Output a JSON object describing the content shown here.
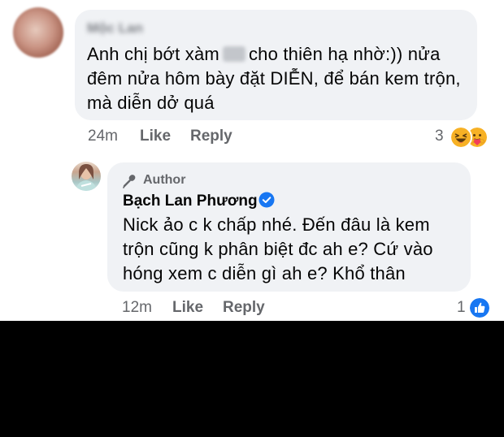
{
  "comment": {
    "author": "Mộc Lan",
    "text_before": "Anh chị bớt xàm",
    "text_after": "cho thiên hạ nhờ:)) nửa đêm nửa hôm bày đặt DIỄN, để bán kem trộn, mà diễn dở quá",
    "time": "24m",
    "like_label": "Like",
    "reply_label": "Reply",
    "reaction_count": "3",
    "reaction_icons": [
      "haha-icon",
      "care-icon"
    ]
  },
  "reply": {
    "author_badge": "Author",
    "author": "Bạch Lan Phương",
    "text": "Nick ảo c k chấp nhé. Đến đâu là kem trộn cũng k phân biệt đc ah e? Cứ vào hóng xem c diễn gì ah e? Khổ thân",
    "time": "12m",
    "like_label": "Like",
    "reply_label": "Reply",
    "reaction_count": "1",
    "reaction_icons": [
      "like-icon"
    ]
  },
  "colors": {
    "bubble": "#f0f2f5",
    "secondary_text": "#65676b",
    "verified_blue": "#1877f2",
    "haha_yellow": "#f7b125",
    "care_red": "#f33e58"
  }
}
